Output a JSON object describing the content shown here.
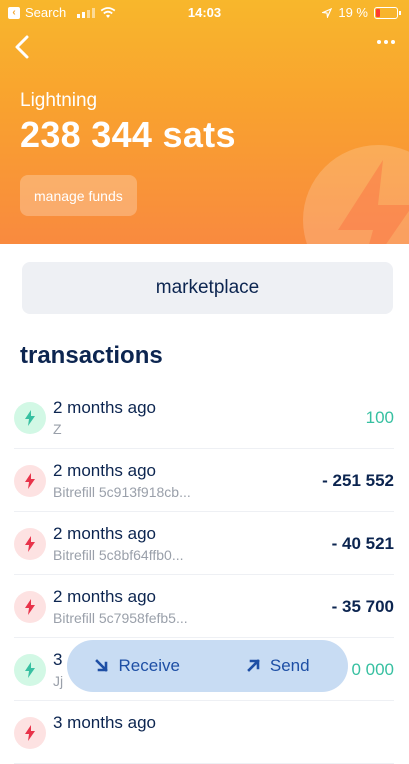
{
  "status_bar": {
    "back_app": "Search",
    "time": "14:03",
    "battery": "19 %"
  },
  "wallet": {
    "label": "Lightning",
    "balance": "238 344 sats",
    "manage_label": "manage funds"
  },
  "marketplace_label": "marketplace",
  "transactions_title": "transactions",
  "transactions": [
    {
      "date": "2 months ago",
      "memo": "Z",
      "amount": "100",
      "direction": "in"
    },
    {
      "date": "2 months ago",
      "memo": "Bitrefill 5c913f918cb...",
      "amount": "- 251 552",
      "direction": "out"
    },
    {
      "date": "2 months ago",
      "memo": "Bitrefill 5c8bf64ffb0...",
      "amount": "- 40 521",
      "direction": "out"
    },
    {
      "date": "2 months ago",
      "memo": "Bitrefill 5c7958fefb5...",
      "amount": "- 35 700",
      "direction": "out"
    },
    {
      "date": "3",
      "memo": "Jj",
      "amount": "0 000",
      "direction": "in"
    },
    {
      "date": "3 months ago",
      "memo": "",
      "amount": "",
      "direction": "out"
    }
  ],
  "actions": {
    "receive": "Receive",
    "send": "Send"
  },
  "colors": {
    "header_top": "#f8b72c",
    "header_bottom": "#f98a3f",
    "incoming": "#37c0a1",
    "outgoing_icon": "#e8334a",
    "text_dark": "#0c2550",
    "action_blue": "#1e4fa5"
  },
  "icons": {
    "incoming": "lightning-bolt-icon",
    "outgoing": "lightning-bolt-icon"
  }
}
